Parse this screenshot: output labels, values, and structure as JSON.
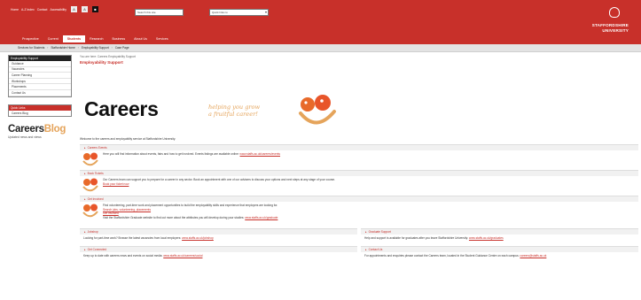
{
  "header": {
    "util_links": [
      "Home",
      "A-Z Index",
      "Contact",
      "Accessibility"
    ],
    "text_size_small": "A",
    "text_size_large": "A",
    "search_placeholder": "Search this site",
    "quick_links_label": "Quick links to",
    "nav": [
      "Prospective",
      "Current",
      "Students",
      "Research",
      "Business",
      "About Us",
      "Services"
    ],
    "active_nav_index": 2,
    "logo_line1": "STAFFORDSHIRE",
    "logo_line2": "UNIVERSITY",
    "accent_color": "#c8302a"
  },
  "breadcrumb": [
    "Services for Students",
    "Staffordshire Home",
    "Employability Support",
    "Case Page"
  ],
  "sidebar": {
    "menu_title": "Employability Support",
    "menu_items": [
      "Guidance",
      "Vacancies",
      "Career Planning",
      "Workshops",
      "Placements",
      "Contact Us"
    ],
    "box_title": "Quick Links",
    "box_item": "Careers Blog",
    "blog_word1": "Careers",
    "blog_word2": "Blog",
    "blog_tagline": "Updated news and views"
  },
  "main": {
    "page_crumb": "You are here: Careers Employability Support",
    "section_title": "Employability Support",
    "banner_heading": "Careers",
    "banner_tagline_1": "helping you grow",
    "banner_tagline_2": "a fruitful career!",
    "intro": "Welcome to the careers and employability service at Staffordshire University.",
    "blocks": [
      {
        "title": "Careers Events",
        "text": "Here you will find information about events, fairs and how to get involved. Events listings are available online:",
        "link": "www.staffs.ac.uk/careers/events"
      },
      {
        "title": "Book Tickets",
        "text": "Our Careers team can support you to prepare for a career in any sector. Book an appointment with one of our advisers to discuss your options and next steps at any stage of your course.",
        "link": "Book your ticket now"
      },
      {
        "title": "Get Involved",
        "text": "Find volunteering, part-time work and placement opportunities to build the employability skills and experience that employers are looking for.",
        "link": "Search jobs, volunteering, placements",
        "link2": "Get involved",
        "text2": "Visit the Staffordshire Graduate website to find out more about the attributes you will develop during your studies:",
        "link3": "www.staffs.ac.uk/graduate"
      }
    ],
    "left_col": [
      {
        "title": "Jobshop",
        "text": "Looking for part-time work? Browse the latest vacancies from local employers:",
        "link": "www.staffs.ac.uk/jobshop"
      },
      {
        "title": "Get Connected",
        "text": "Keep up to date with careers news and events on social media:",
        "link": "www.staffs.ac.uk/careers/social"
      }
    ],
    "right_col": [
      {
        "title": "Graduate Support",
        "text": "Help and support is available for graduates after you leave Staffordshire University:",
        "link": "www.staffs.ac.uk/graduates"
      },
      {
        "title": "Contact Us",
        "text": "For appointments and enquiries please contact the Careers team, located in the Student Guidance Centre on each campus:",
        "link": "careers@staffs.ac.uk"
      }
    ]
  }
}
